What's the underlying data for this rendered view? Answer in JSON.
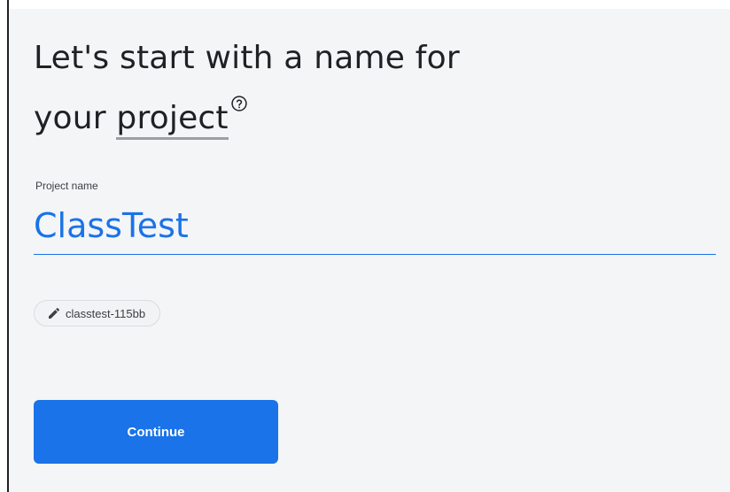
{
  "heading": {
    "line1": "Let's start with a name for",
    "prefix": "your ",
    "term": "project"
  },
  "project_name": {
    "label": "Project name",
    "value": "ClassTest"
  },
  "project_id": {
    "value": "classtest-115bb",
    "icon": "pencil-icon"
  },
  "help_icon": "help-circle-icon",
  "actions": {
    "continue_label": "Continue"
  },
  "colors": {
    "accent": "#1a73e8",
    "page_background": "#f4f5f7",
    "heading_text": "#202124"
  }
}
